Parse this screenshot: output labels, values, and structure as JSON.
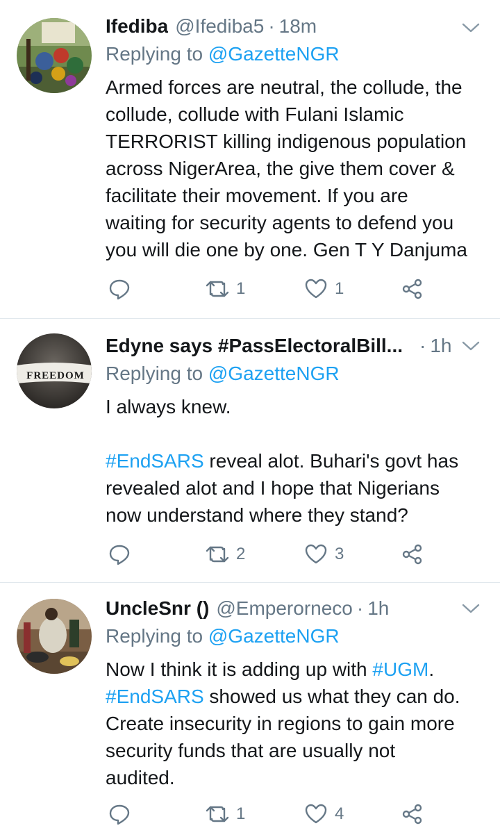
{
  "tweets": [
    {
      "name": "Ifediba",
      "handle": "@Ifediba5",
      "time": "18m",
      "replying_prefix": "Replying to",
      "replying_to": "@GazetteNGR",
      "lines": [
        "Armed forces are neutral, the collude, the",
        "collude, collude with Fulani Islamic",
        "TERRORIST killing indigenous population",
        "across NigerArea, the give them cover &",
        "facilitate their movement. If you are",
        "waiting for security agents to defend you",
        "you will die one by one. Gen T Y Danjuma"
      ],
      "retweets": "1",
      "likes": "1"
    },
    {
      "name": "Edyne says #PassElectoralBill...",
      "handle": "",
      "time": "1h",
      "replying_prefix": "Replying to",
      "replying_to": "@GazetteNGR",
      "avatar_text": "FREEDOM",
      "line1": "I always knew.",
      "tag": "#EndSARS",
      "line2_rest": " reveal alot. Buhari's govt has",
      "line3": "revealed alot and I hope that Nigerians",
      "line4": "now understand where they stand?",
      "retweets": "2",
      "likes": "3"
    },
    {
      "name": "UncleSnr ()",
      "handle": "@Emperorneco",
      "time": "1h",
      "replying_prefix": "Replying to",
      "replying_to": "@GazetteNGR",
      "line1_pre": "Now I think it is adding up with ",
      "tag1": "#UGM",
      "line1_post": ".",
      "tag2": "#EndSARS",
      "line2_rest": " showed us what they can do.",
      "line3": "Create insecurity in regions to gain more",
      "line4": "security funds that are usually not",
      "line5": "audited.",
      "retweets": "1",
      "likes": "4"
    }
  ],
  "colors": {
    "text": "#14171a",
    "secondary": "#657786",
    "link": "#1da1f2",
    "divider": "#e1e8ed"
  }
}
